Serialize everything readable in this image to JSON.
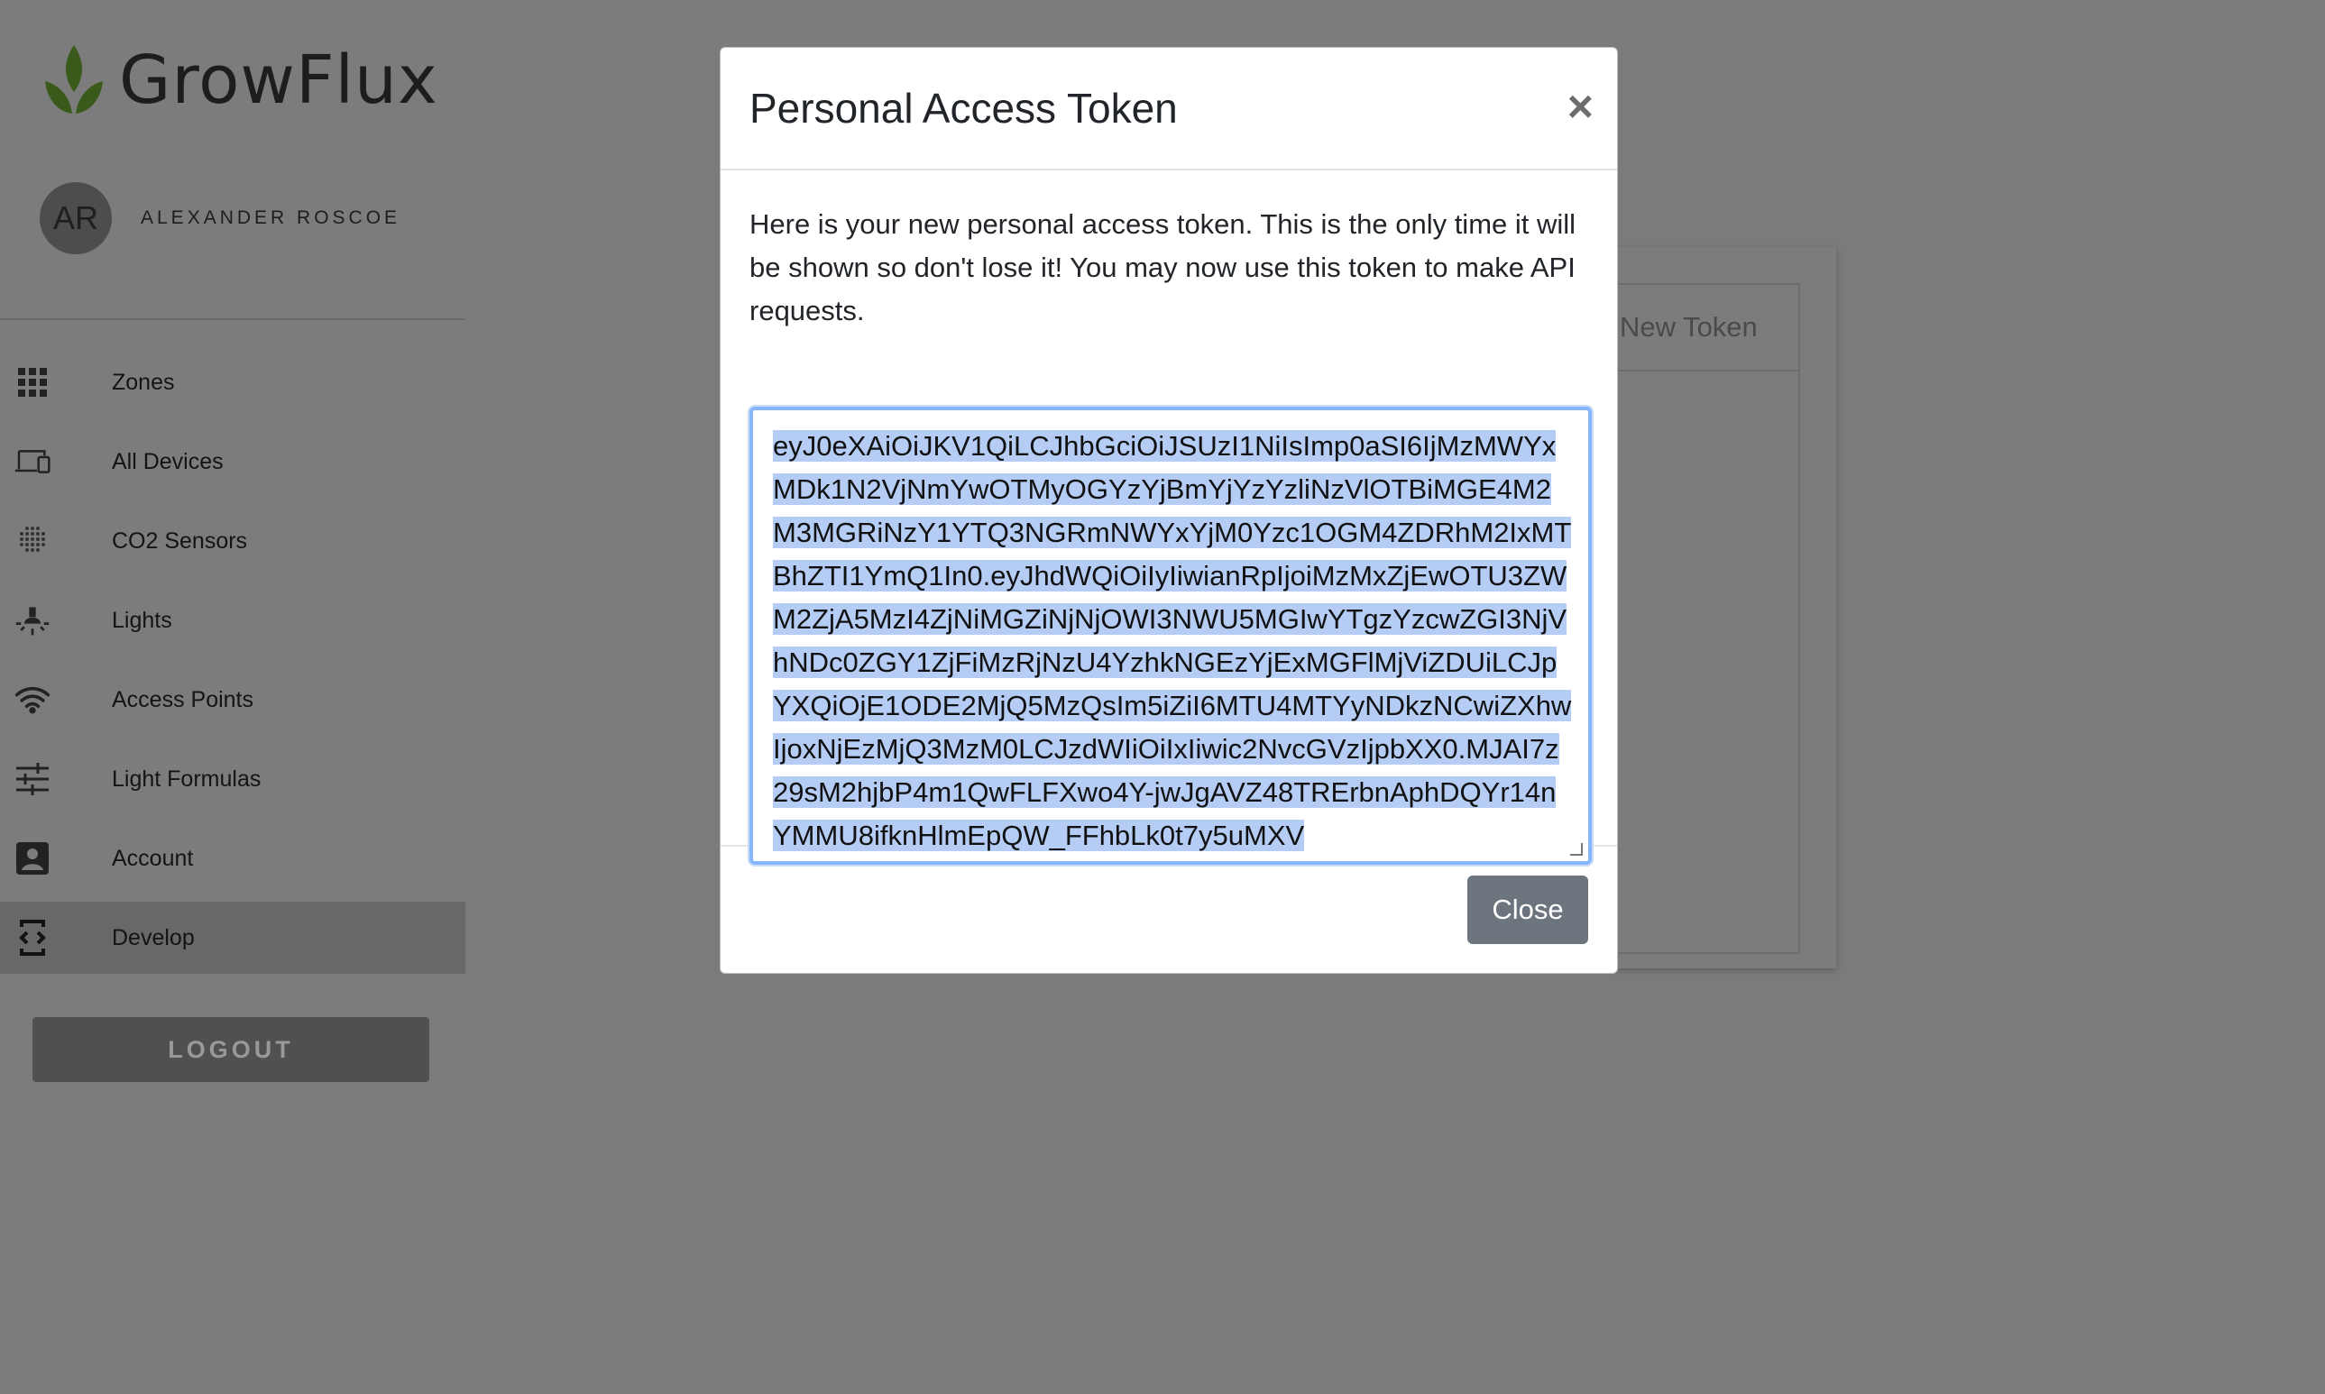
{
  "app": {
    "name": "GrowFlux"
  },
  "user": {
    "initials": "AR",
    "name": "ALEXANDER ROSCOE"
  },
  "nav": {
    "items": [
      {
        "label": "Zones",
        "icon": "grid-icon",
        "active": false
      },
      {
        "label": "All Devices",
        "icon": "devices-icon",
        "active": false
      },
      {
        "label": "CO2 Sensors",
        "icon": "sensor-dots-icon",
        "active": false
      },
      {
        "label": "Lights",
        "icon": "light-icon",
        "active": false
      },
      {
        "label": "Access Points",
        "icon": "wifi-icon",
        "active": false
      },
      {
        "label": "Light Formulas",
        "icon": "sliders-icon",
        "active": false
      },
      {
        "label": "Account",
        "icon": "account-box-icon",
        "active": false
      },
      {
        "label": "Develop",
        "icon": "developer-icon",
        "active": true
      }
    ]
  },
  "logout_label": "LOGOUT",
  "background": {
    "card_header": "New Token"
  },
  "modal": {
    "title": "Personal Access Token",
    "close_glyph": "×",
    "message": "Here is your new personal access token. This is the only time it will be shown so don't lose it! You may now use this token to make API requests.",
    "token": "eyJ0eXAiOiJKV1QiLCJhbGciOiJSUzI1NiIsImp0aSI6IjMzMWYxMDk1N2VjNmYwOTMyOGYzYjBmYjYzYzliNzVlOTBiMGE4M2M3MGRiNzY1YTQ3NGRmNWYxYjM0Yzc1OGM4ZDRhM2IxMTBhZTI1YmQ1In0.eyJhdWQiOiIyIiwianRpIjoiMzMxZjEwOTU3ZWM2ZjA5MzI4ZjNiMGZiNjNjOWI3NWU5MGIwYTgzYzcwZGI3NjVhNDc0ZGY1ZjFiMzRjNzU4YzhkNGEzYjExMGFlMjViZDUiLCJpYXQiOjE1ODE2MjQ5MzQsIm5iZiI6MTU4MTYyNDkzNCwiZXhwIjoxNjEzMjQ3MzM0LCJzdWIiOiIxIiwic2NvcGVzIjpbXX0.MJAI7z29sM2hjbP4m1QwFLFXwo4Y-jwJgAVZ48TRErbnAphDQYr14nYMMU8ifknHlmEpQW_FFhbLk0t7y5uMXV",
    "close_label": "Close"
  }
}
